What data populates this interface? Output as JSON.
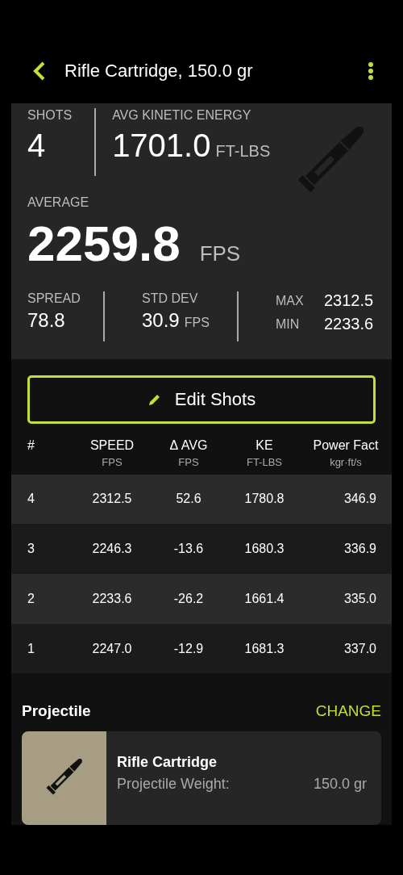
{
  "header": {
    "title": "Rifle Cartridge, 150.0 gr"
  },
  "summary": {
    "shots_label": "SHOTS",
    "shots": "4",
    "energy_label": "AVG KINETIC ENERGY",
    "energy": "1701.0",
    "energy_unit": "FT-LBS",
    "average_label": "AVERAGE",
    "average": "2259.8",
    "average_unit": "FPS",
    "spread_label": "SPREAD",
    "spread": "78.8",
    "std_label": "STD DEV",
    "std": "30.9",
    "std_unit": "FPS",
    "max_label": "MAX",
    "max": "2312.5",
    "min_label": "MIN",
    "min": "2233.6"
  },
  "edit_button": "Edit Shots",
  "table": {
    "columns": [
      {
        "label": "#"
      },
      {
        "label": "SPEED",
        "unit": "FPS"
      },
      {
        "label": "Δ AVG",
        "unit": "FPS"
      },
      {
        "label": "KE",
        "unit": "FT-LBS"
      },
      {
        "label": "Power Fact",
        "unit": "kgr·ft/s"
      }
    ],
    "rows": [
      [
        "4",
        "2312.5",
        "52.6",
        "1780.8",
        "346.9"
      ],
      [
        "3",
        "2246.3",
        "-13.6",
        "1680.3",
        "336.9"
      ],
      [
        "2",
        "2233.6",
        "-26.2",
        "1661.4",
        "335.0"
      ],
      [
        "1",
        "2247.0",
        "-12.9",
        "1681.3",
        "337.0"
      ]
    ]
  },
  "projectile": {
    "title": "Projectile",
    "action": "CHANGE",
    "name": "Rifle Cartridge",
    "weight_label": "Projectile Weight:",
    "weight": "150.0 gr"
  }
}
